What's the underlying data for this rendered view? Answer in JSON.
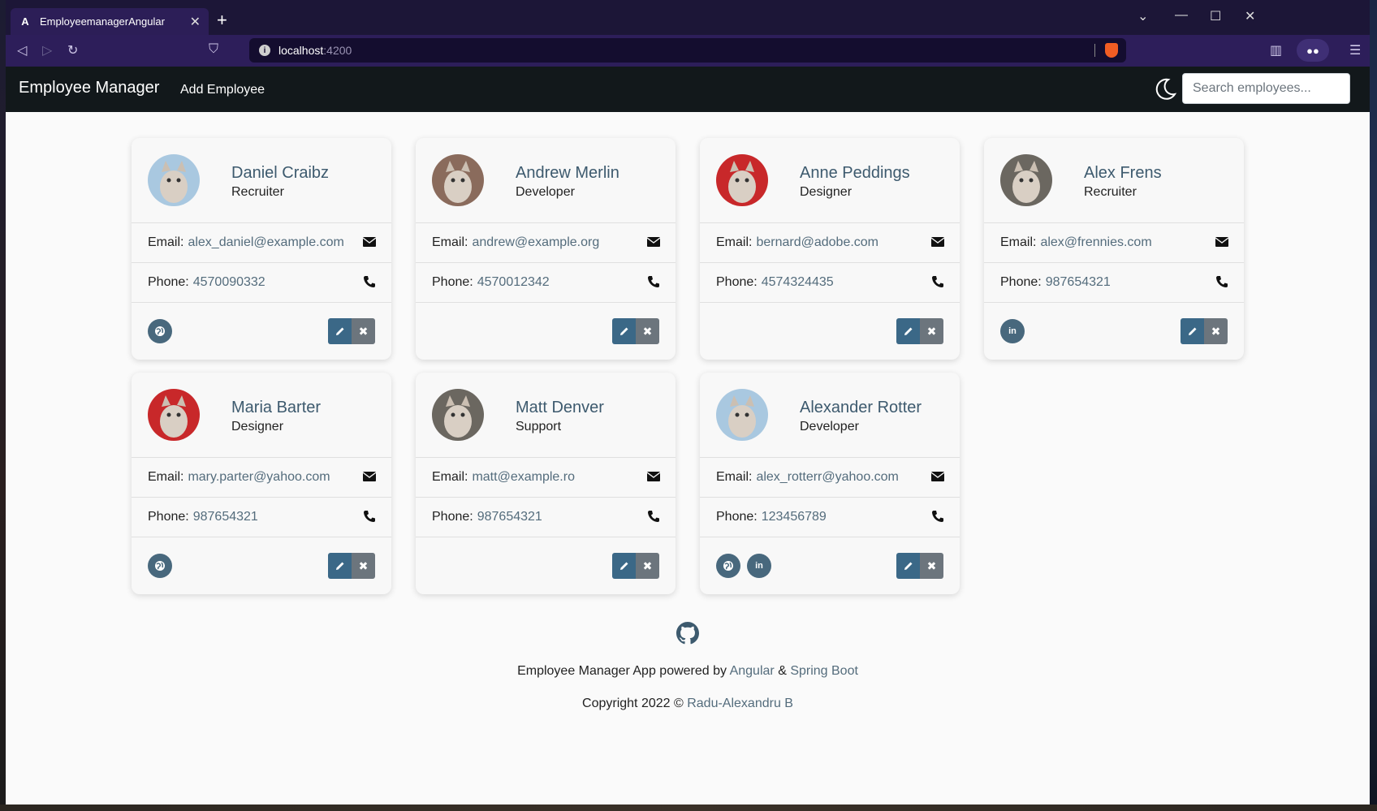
{
  "browser": {
    "tab_title": "EmployeemanagerAngular",
    "tab_favicon": "A",
    "new_tab": "+",
    "url_host": "localhost",
    "url_port": ":4200"
  },
  "navbar": {
    "brand": "Employee Manager",
    "add_employee": "Add Employee",
    "search_placeholder": "Search employees...",
    "theme_icon": "moon-icon"
  },
  "employees": [
    {
      "name": "Daniel Craibz",
      "job": "Recruiter",
      "email_label": "Email:",
      "email": "alex_daniel@example.com",
      "phone_label": "Phone:",
      "phone": "4570090332",
      "avatar_color": "#a9c8e0",
      "links": [
        "globe"
      ]
    },
    {
      "name": "Andrew Merlin",
      "job": "Developer",
      "email_label": "Email:",
      "email": "andrew@example.org",
      "phone_label": "Phone:",
      "phone": "4570012342",
      "avatar_color": "#8a6b5c",
      "links": []
    },
    {
      "name": "Anne Peddings",
      "job": "Designer",
      "email_label": "Email:",
      "email": "bernard@adobe.com",
      "phone_label": "Phone:",
      "phone": "4574324435",
      "avatar_color": "#c8282a",
      "links": []
    },
    {
      "name": "Alex Frens",
      "job": "Recruiter",
      "email_label": "Email:",
      "email": "alex@frennies.com",
      "phone_label": "Phone:",
      "phone": "987654321",
      "avatar_color": "#6b6760",
      "links": [
        "linkedin"
      ]
    },
    {
      "name": "Maria Barter",
      "job": "Designer",
      "email_label": "Email:",
      "email": "mary.parter@yahoo.com",
      "phone_label": "Phone:",
      "phone": "987654321",
      "avatar_color": "#c8282a",
      "links": [
        "globe"
      ]
    },
    {
      "name": "Matt Denver",
      "job": "Support",
      "email_label": "Email:",
      "email": "matt@example.ro",
      "phone_label": "Phone:",
      "phone": "987654321",
      "avatar_color": "#6b6760",
      "links": []
    },
    {
      "name": "Alexander Rotter",
      "job": "Developer",
      "email_label": "Email:",
      "email": "alex_rotterr@yahoo.com",
      "phone_label": "Phone:",
      "phone": "123456789",
      "avatar_color": "#a9c8e0",
      "links": [
        "globe",
        "linkedin"
      ]
    }
  ],
  "footer": {
    "line1_prefix": "Employee Manager App powered by",
    "angular": "Angular",
    "amp": "&",
    "spring": "Spring Boot",
    "line2_prefix": "Copyright 2022 ©",
    "author": "Radu-Alexandru B"
  },
  "colors": {
    "accent": "#3b6887",
    "name": "#3d5a6e",
    "navbar": "#12181b"
  }
}
